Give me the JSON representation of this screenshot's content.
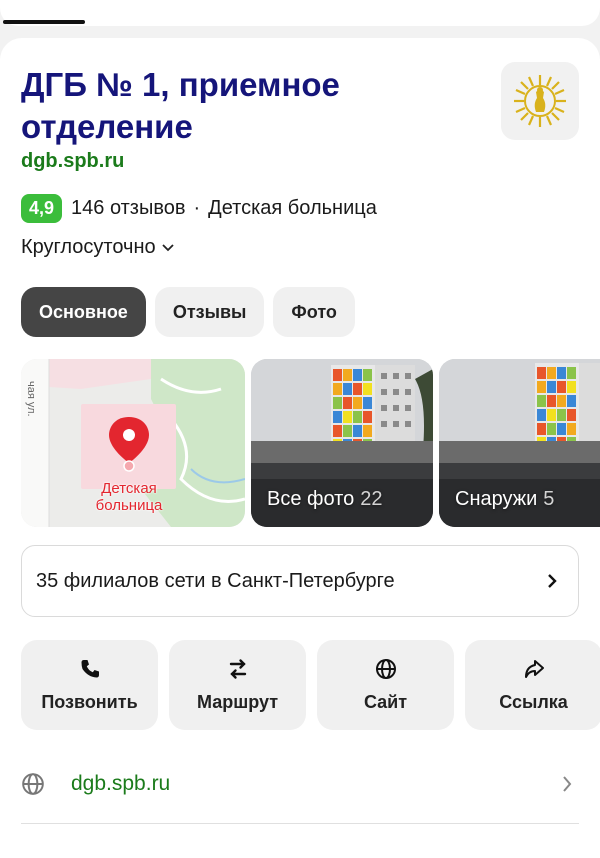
{
  "top_tabs_hint": "· · · · · · · · · · · · · · · · · · ·",
  "place": {
    "title": "ДГБ № 1, приемное отделение",
    "website_short": "dgb.spb.ru",
    "rating": "4,9",
    "reviews": "146 отзывов",
    "separator": "·",
    "category": "Детская больница",
    "hours": "Круглосуточно"
  },
  "tabs": [
    {
      "label": "Основное",
      "active": true
    },
    {
      "label": "Отзывы",
      "active": false
    },
    {
      "label": "Фото",
      "active": false
    }
  ],
  "map_tile": {
    "pin_label": "Детская больница",
    "street_fragment": "чая ул."
  },
  "photo_tiles": [
    {
      "label": "Все фото",
      "count": "22"
    },
    {
      "label": "Снаружи",
      "count": "5"
    }
  ],
  "branches": {
    "label": "35 филиалов сети в Санкт-Петербурге"
  },
  "actions": [
    {
      "label": "Позвонить",
      "icon": "phone-icon"
    },
    {
      "label": "Маршрут",
      "icon": "route-icon"
    },
    {
      "label": "Сайт",
      "icon": "globe-icon"
    },
    {
      "label": "Ссылка",
      "icon": "share-icon"
    }
  ],
  "link_row": {
    "url": "dgb.spb.ru"
  },
  "colors": {
    "title": "#15157a",
    "link_green": "#1b7b1b",
    "rating_badge": "#3bbd3b",
    "active_tab": "#454545",
    "pin_red": "#e3262f"
  }
}
